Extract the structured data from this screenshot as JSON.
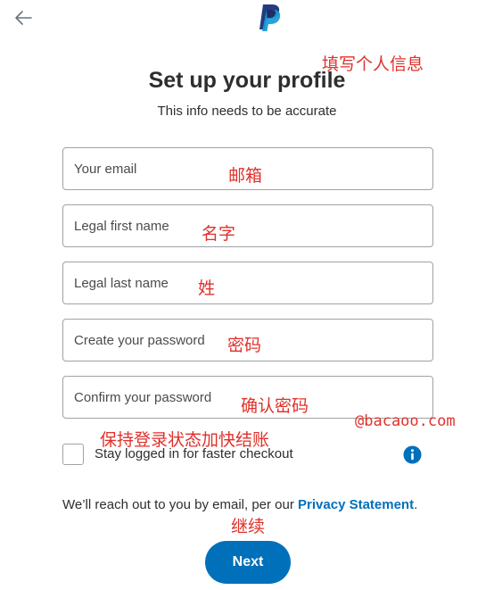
{
  "header": {
    "back_icon": "arrow-left-icon",
    "logo": "paypal-logo"
  },
  "title": "Set up your profile",
  "subtitle": "This info needs to be accurate",
  "fields": [
    {
      "placeholder": "Your email",
      "value": "",
      "note": "邮箱"
    },
    {
      "placeholder": "Legal first name",
      "value": "",
      "note": "名字"
    },
    {
      "placeholder": "Legal last name",
      "value": "",
      "note": "姓"
    },
    {
      "placeholder": "Create your password",
      "value": "",
      "note": "密码"
    },
    {
      "placeholder": "Confirm your password",
      "value": "",
      "note": "确认密码"
    }
  ],
  "annotations": {
    "top": "填写个人信息",
    "stay_logged": "保持登录状态加快结账",
    "next": "继续",
    "watermark": "@bacaoo.com"
  },
  "stay_logged_in": {
    "label": "Stay logged in for faster checkout",
    "checked": false,
    "info_icon": "info-icon"
  },
  "disclaimer": {
    "text": "We’ll reach out to you by email, per our ",
    "link": "Privacy Statement",
    "end": "."
  },
  "next_button": "Next",
  "colors": {
    "brand_blue": "#0070ba",
    "annotation_red": "#e0312b",
    "border": "#9da3a6"
  }
}
